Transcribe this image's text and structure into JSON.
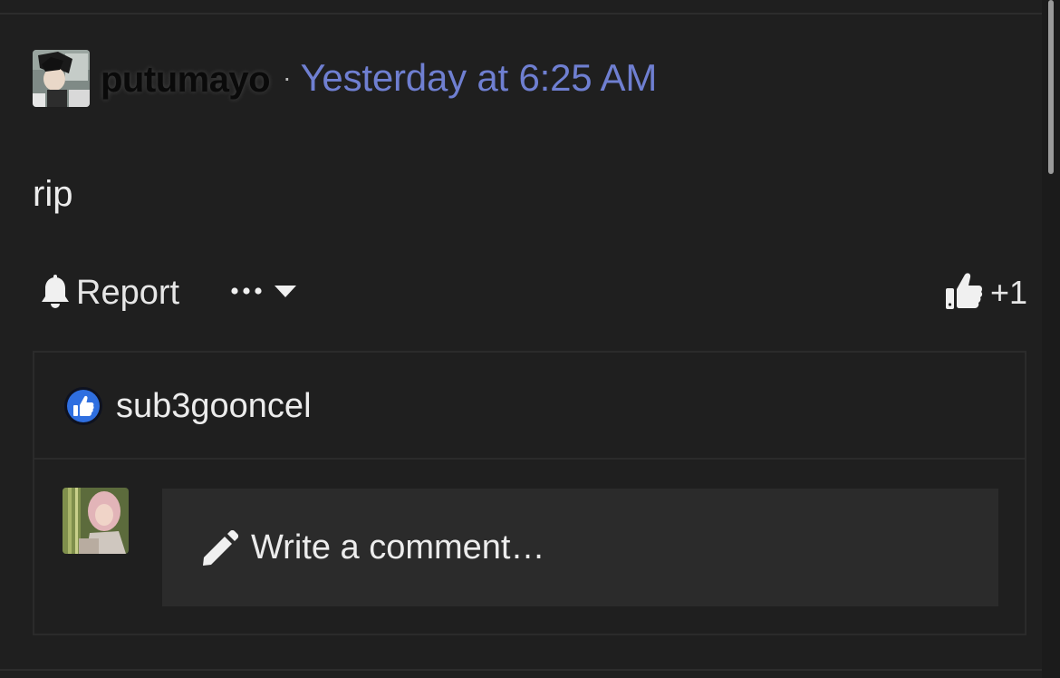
{
  "post": {
    "author": "putumayo",
    "separator": "·",
    "timestamp": "Yesterday at 6:25 AM",
    "body": "rip"
  },
  "actions": {
    "report_label": "Report",
    "more_icon": "ellipsis-icon",
    "dropdown_icon": "chevron-down-icon",
    "like_icon": "thumbs-up-icon",
    "like_count": "+1"
  },
  "reactions": {
    "badge_icon": "like-badge-icon",
    "users": [
      "sub3gooncel"
    ]
  },
  "comment": {
    "placeholder": "Write a comment…",
    "icon": "pencil-icon"
  },
  "colors": {
    "background": "#1f1f1f",
    "timestamp": "#6f7fd1",
    "input_bg": "#2b2b2b",
    "like_badge": "#2f6fe0"
  }
}
